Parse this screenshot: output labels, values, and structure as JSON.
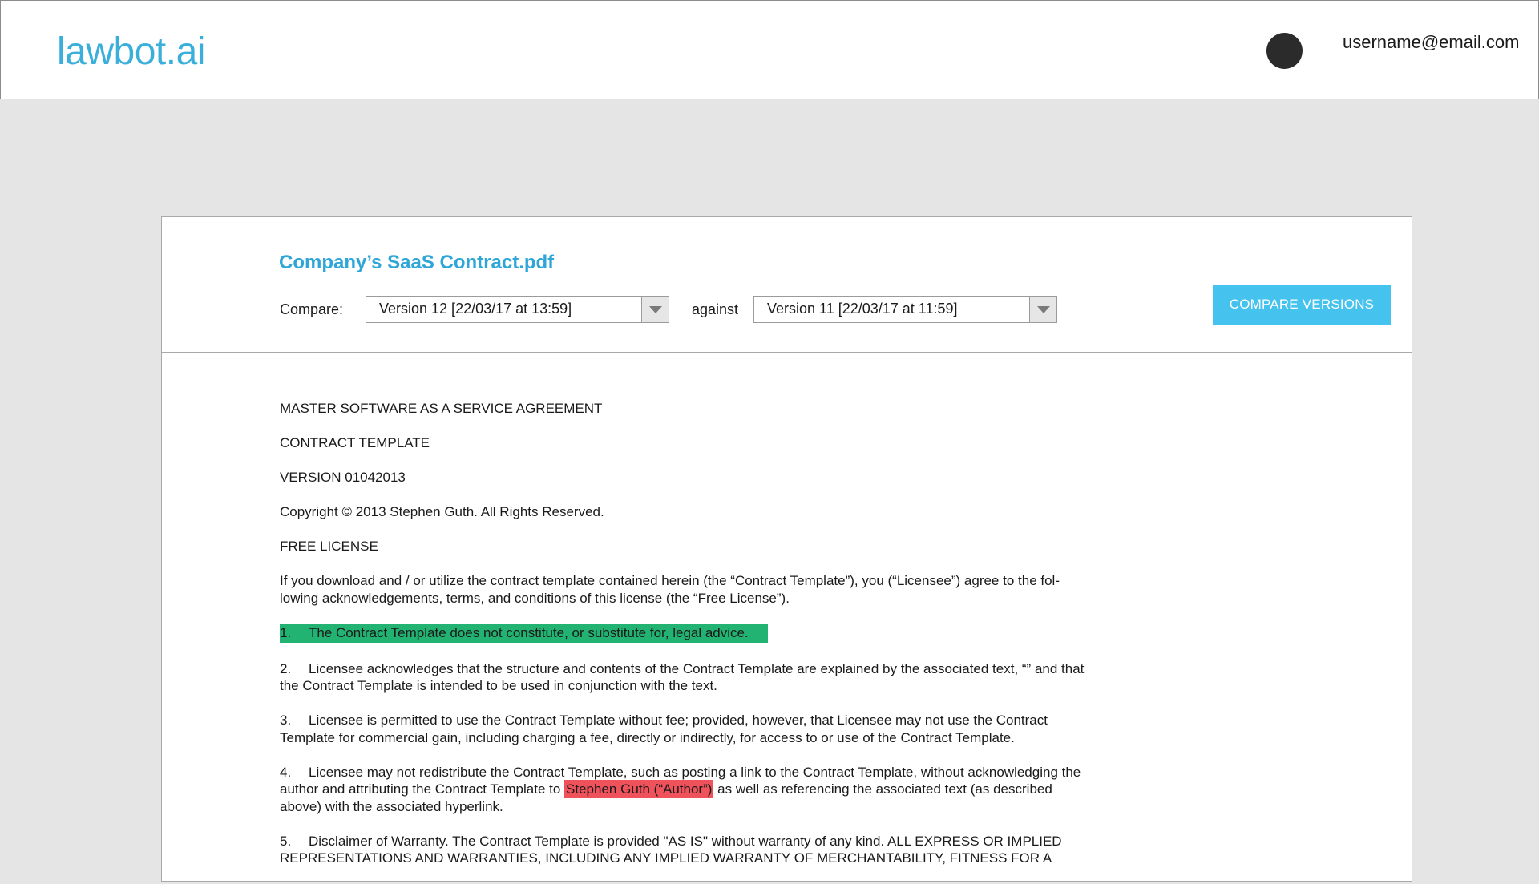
{
  "header": {
    "logo": "lawbot.ai",
    "user_email": "username@email.com"
  },
  "document": {
    "title": "Company’s SaaS Contract.pdf"
  },
  "compare": {
    "label": "Compare:",
    "against_label": "against",
    "version_a": "Version 12 [22/03/17 at 13:59]",
    "version_b": "Version 11 [22/03/17 at 11:59]",
    "button_label": "COMPARE VERSIONS"
  },
  "content": {
    "heading1": "MASTER SOFTWARE AS A SERVICE AGREEMENT",
    "heading2": "CONTRACT TEMPLATE",
    "heading3": "VERSION 01042013",
    "copyright": "Copyright © 2013 Stephen Guth. All Rights Reserved.",
    "heading4": "FREE LICENSE",
    "intro": "If you download and / or utilize the contract template contained herein (the “Contract Template”), you (“Licensee”) agree to the fol-lowing acknowledgements, terms, and conditions of this license (the “Free License”).",
    "items": [
      {
        "num": "1.",
        "text": "The Contract Template does not constitute, or substitute for, legal advice."
      },
      {
        "num": "2.",
        "text": "Licensee acknowledges that the structure and contents of the Contract Template are explained by the associated text, “” and that the Contract Template is intended to be used in conjunction with the text."
      },
      {
        "num": "3.",
        "text": "Licensee is permitted to use the Contract Template without fee; provided, however, that Licensee may not use the Contract Template for commercial gain, including charging a fee, directly or indirectly, for access to or use of the Contract Template."
      },
      {
        "num": "4.",
        "text_before": "Licensee may not redistribute the Contract Template, such as posting a link to the Contract Template, without acknowledging the author and attributing the Contract Template to",
        "removed": "Stephen Guth (“Author”)",
        "text_after": "as well as referencing the associated text (as described above) with the associated hyperlink."
      },
      {
        "num": "5.",
        "text": "Disclaimer of Warranty. The Contract Template is provided \"AS IS\" without warranty of any kind. ALL EXPRESS OR IMPLIED REPRESENTATIONS AND WARRANTIES, INCLUDING ANY IMPLIED WARRANTY OF MERCHANTABILITY, FITNESS FOR A"
      }
    ]
  },
  "colors": {
    "brand": "#3aafdc",
    "button": "#45c3ee",
    "added_highlight": "#22b372",
    "removed_highlight": "#f0525c"
  }
}
